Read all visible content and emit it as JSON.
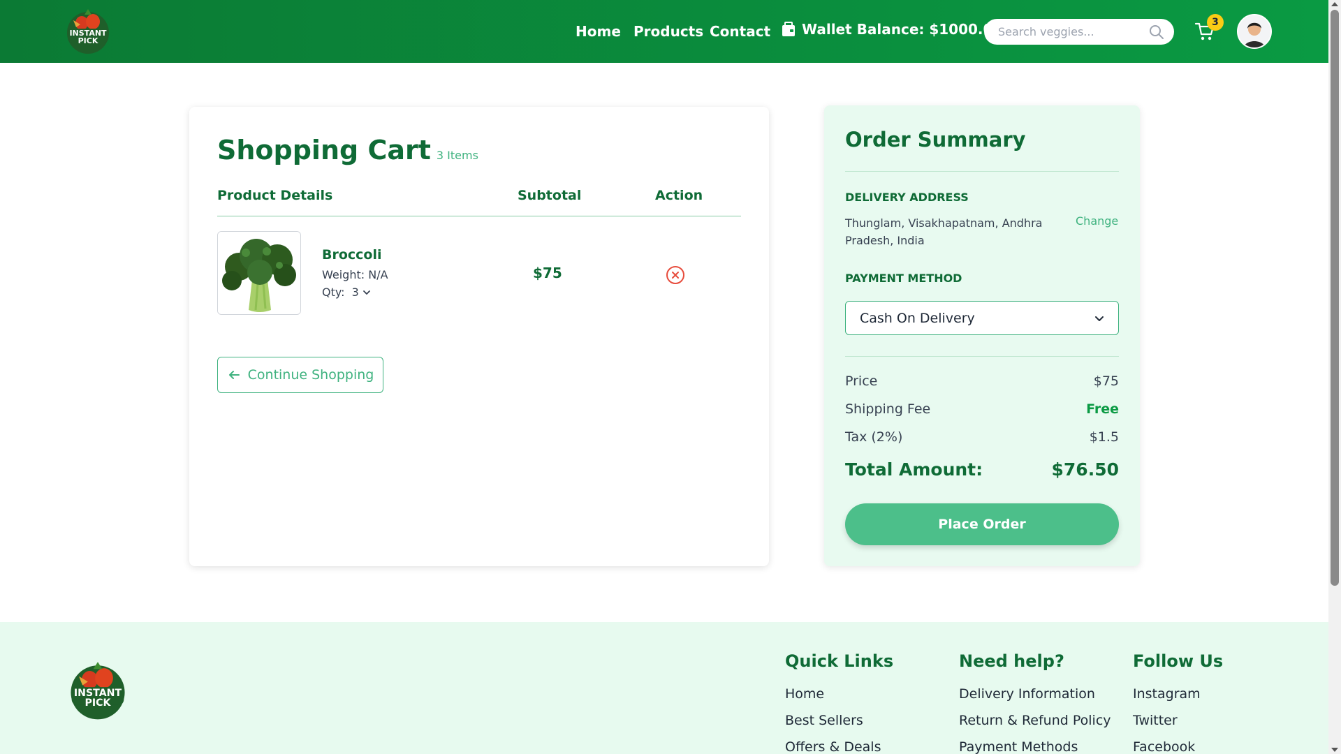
{
  "header": {
    "logo_text": "INSTANT PICK",
    "nav": [
      "Home",
      "Products",
      "Contact"
    ],
    "wallet_label": "Wallet Balance: $1000.00",
    "search_placeholder": "Search veggies...",
    "cart_count": "3"
  },
  "cart": {
    "title": "Shopping Cart",
    "count_label": "3 Items",
    "columns": [
      "Product Details",
      "Subtotal",
      "Action"
    ],
    "items": [
      {
        "name": "Broccoli",
        "weight": "Weight: N/A",
        "qty_label": "Qty:",
        "qty": "3",
        "subtotal": "$75"
      }
    ],
    "continue_label": "Continue Shopping"
  },
  "summary": {
    "title": "Order Summary",
    "delivery_label": "DELIVERY ADDRESS",
    "address": "Thunglam, Visakhapatnam, Andhra Pradesh, India",
    "change_label": "Change",
    "payment_label": "PAYMENT METHOD",
    "payment_selected": "Cash On Delivery",
    "price_label": "Price",
    "price_value": "$75",
    "shipping_label": "Shipping Fee",
    "shipping_value": "Free",
    "tax_label": "Tax (2%)",
    "tax_value": "$1.5",
    "total_label": "Total Amount:",
    "total_value": "$76.50",
    "place_order_label": "Place Order"
  },
  "footer": {
    "logo_text": "INSTANT PICK",
    "quick_links": {
      "title": "Quick Links",
      "links": [
        "Home",
        "Best Sellers",
        "Offers & Deals"
      ]
    },
    "help": {
      "title": "Need help?",
      "links": [
        "Delivery Information",
        "Return & Refund Policy",
        "Payment Methods"
      ]
    },
    "follow": {
      "title": "Follow Us",
      "links": [
        "Instagram",
        "Twitter",
        "Facebook"
      ]
    }
  },
  "colors": {
    "brand_green": "#0a9a43",
    "dark_green": "#0f6b36",
    "accent_green": "#3fb27f",
    "remove_red": "#e74c3c",
    "badge_yellow": "#facc15"
  }
}
